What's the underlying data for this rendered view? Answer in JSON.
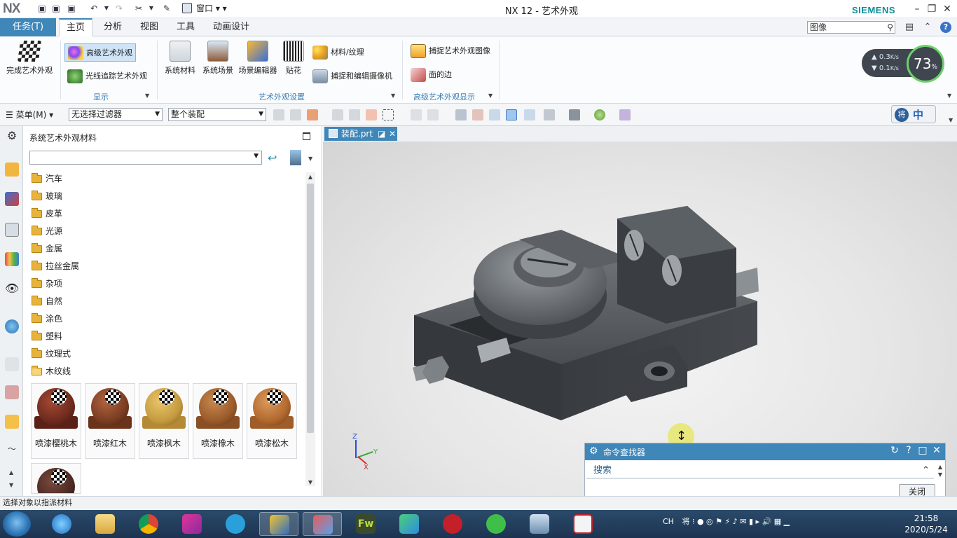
{
  "app": {
    "logo": "NX",
    "title": "NX 12 - 艺术外观",
    "brand": "SIEMENS",
    "window_menu": "窗口"
  },
  "tabs": {
    "task": "任务(T)",
    "items": [
      "主页",
      "分析",
      "视图",
      "工具",
      "动画设计"
    ],
    "active": "主页",
    "search_value": "图像"
  },
  "ribbon": {
    "finish_label": "完成艺术外观",
    "display": {
      "advanced_label": "高级艺术外观",
      "raytrace_label": "光线追踪艺术外观",
      "group_label": "显示"
    },
    "settings": {
      "system_material_label": "系统材料",
      "system_scene_label": "系统场景",
      "scene_editor_label": "场景编辑器",
      "decal_label": "贴花",
      "material_texture_label": "材料/纹理",
      "capture_camera_label": "捕捉和编辑摄像机",
      "group_label": "艺术外观设置"
    },
    "advanced_display": {
      "capture_image_label": "捕捉艺术外观图像",
      "face_edge_label": "面的边",
      "group_label": "高级艺术外观显示"
    }
  },
  "speed_widget": {
    "upload": "0.3",
    "download": "0.1",
    "unit": "K/s",
    "percent_text": "73",
    "percent_unit": "%"
  },
  "toolbar": {
    "menu_label": "菜单(M)",
    "filter_value": "无选择过滤器",
    "assembly_value": "整个装配",
    "ime_label": "中"
  },
  "panel": {
    "title": "系统艺术外观材料",
    "tree": [
      "汽车",
      "玻璃",
      "皮革",
      "光源",
      "金属",
      "拉丝金属",
      "杂项",
      "自然",
      "涂色",
      "塑料",
      "纹理式",
      "木纹线"
    ],
    "open_folder": "木纹线",
    "materials": [
      {
        "label": "喷漆樱桃木",
        "color": "#6e2a1e",
        "base": "#5a2216"
      },
      {
        "label": "喷漆红木",
        "color": "#7a3c22",
        "base": "#6b331c"
      },
      {
        "label": "喷漆枫木",
        "color": "#c59a3e",
        "base": "#b48a35"
      },
      {
        "label": "喷漆橡木",
        "color": "#9a5a2a",
        "base": "#8a4f24"
      },
      {
        "label": "喷漆松木",
        "color": "#b0682e",
        "base": "#9f5d29"
      },
      {
        "label": "",
        "color": "#4a2a22",
        "base": "#3e231c"
      }
    ]
  },
  "document": {
    "tab_label": "装配.prt"
  },
  "triad": {
    "x": "X",
    "y": "Y",
    "z": "Z"
  },
  "command_finder": {
    "title": "命令查找器",
    "search_label": "搜索",
    "close_label": "关闭"
  },
  "status": {
    "text": "选择对象以指派材料"
  },
  "taskbar": {
    "tray_lang": "CH",
    "time": "21:58",
    "date": "2020/5/24"
  }
}
